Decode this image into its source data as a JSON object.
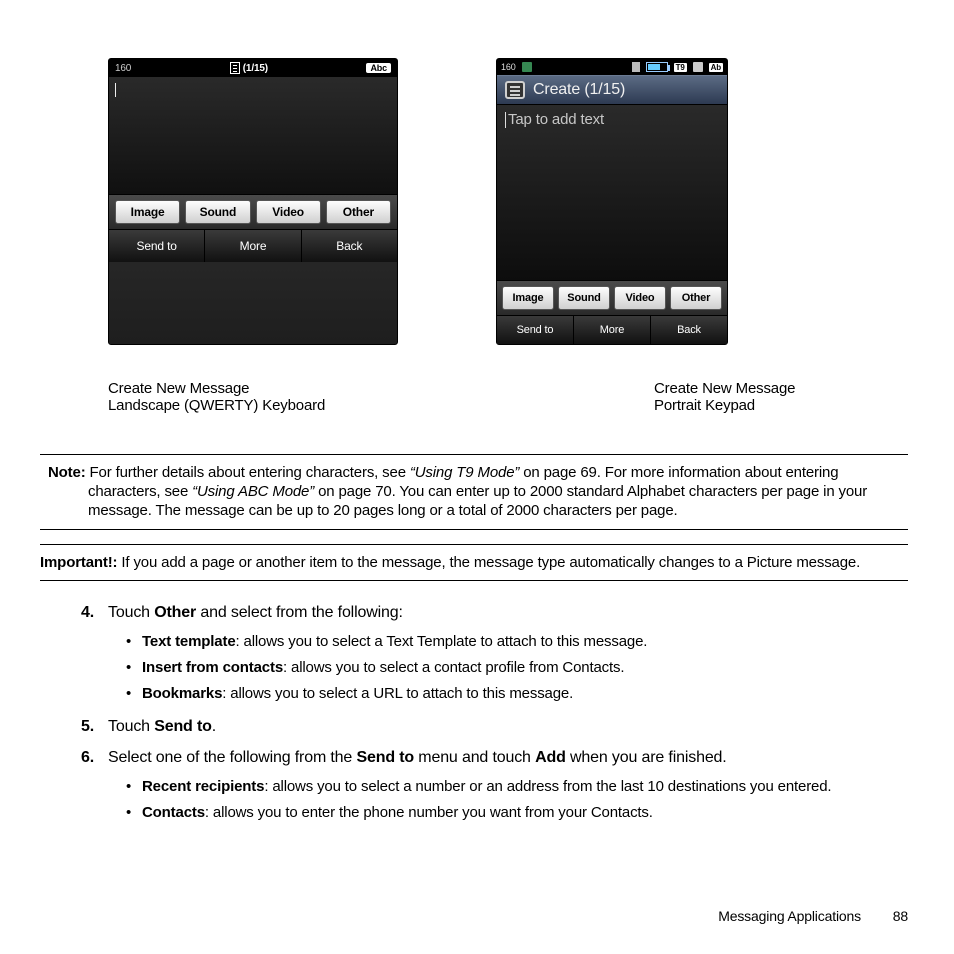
{
  "phone_landscape": {
    "char_counter": "160",
    "page_indicator": "(1/15)",
    "input_mode_badge": "Abc",
    "attach_buttons": [
      "Image",
      "Sound",
      "Video",
      "Other"
    ],
    "softkeys": [
      "Send to",
      "More",
      "Back"
    ]
  },
  "phone_portrait": {
    "char_counter": "160",
    "status_badges": [
      "T9",
      "Ab"
    ],
    "title": "Create (1/15)",
    "placeholder": "Tap to add text",
    "attach_buttons": [
      "Image",
      "Sound",
      "Video",
      "Other"
    ],
    "softkeys": [
      "Send to",
      "More",
      "Back"
    ]
  },
  "captions": {
    "landscape_line1": "Create New Message",
    "landscape_line2": "Landscape (QWERTY) Keyboard",
    "portrait_line1": "Create New Message",
    "portrait_line2": "Portrait Keypad"
  },
  "note": {
    "label": "Note:",
    "before_ref1": "For further details about entering characters, see ",
    "ref1": "“Using T9 Mode”",
    "after_ref1": " on page 69. For more information about entering characters, see ",
    "ref2": "“Using ABC Mode”",
    "after_ref2": " on page 70. You can enter up to 2000 standard Alphabet characters per page in your message. The message can be up to 20 pages long or a total of 2000 characters per page."
  },
  "important": {
    "label": "Important!:",
    "text": "If you add a page or another item to the message, the message type automatically changes to a Picture message."
  },
  "steps": {
    "s4": {
      "num": "4.",
      "pre": "Touch ",
      "bold": "Other",
      "post": " and select from the following:",
      "bullets": [
        {
          "b": "Text template",
          "rest": ": allows you to select a Text Template to attach to this message."
        },
        {
          "b": "Insert from contacts",
          "rest": ": allows you to select a contact profile from Contacts."
        },
        {
          "b": "Bookmarks",
          "rest": ": allows you to select a URL to attach to this message."
        }
      ]
    },
    "s5": {
      "num": "5.",
      "pre": "Touch ",
      "bold": "Send to",
      "post": "."
    },
    "s6": {
      "num": "6.",
      "pre": "Select one of the following from the ",
      "bold1": "Send to",
      "mid": " menu and touch ",
      "bold2": "Add",
      "post": " when you are finished.",
      "bullets": [
        {
          "b": "Recent recipients",
          "rest": ": allows you to select a number or an address from the last 10 destinations you entered."
        },
        {
          "b": "Contacts",
          "rest": ": allows you to enter the phone number you want from your Contacts."
        }
      ]
    }
  },
  "footer": {
    "section": "Messaging Applications",
    "page": "88"
  }
}
